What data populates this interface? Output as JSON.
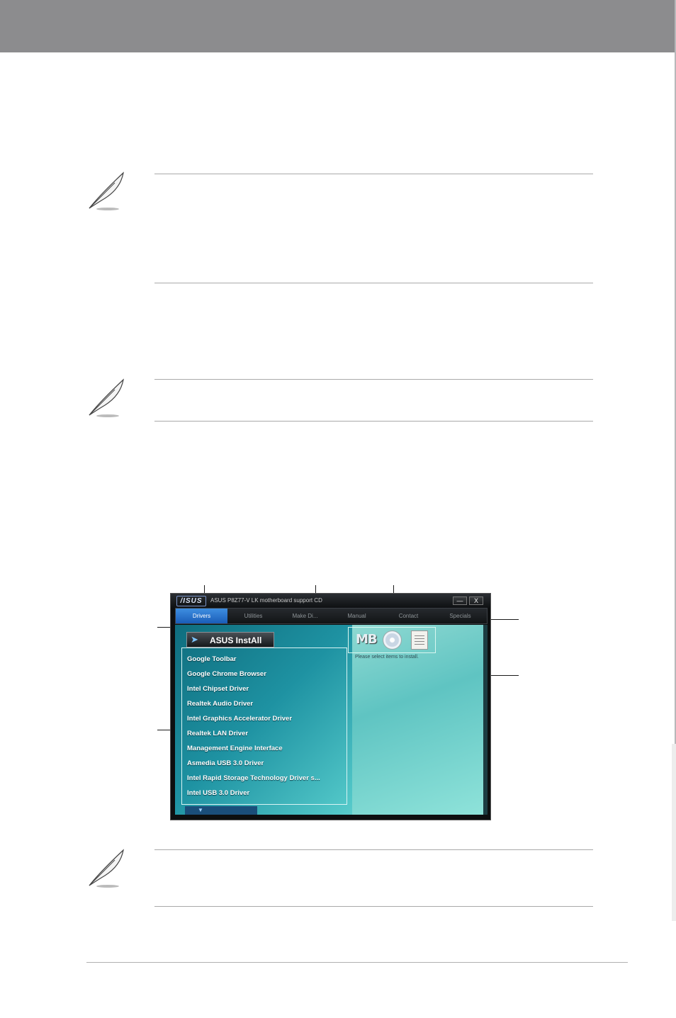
{
  "window": {
    "logo": "/ISUS",
    "title": "ASUS P8Z77-V LK motherboard support CD",
    "minimize_label": "—",
    "close_label": "X"
  },
  "tabs": [
    {
      "label": "Drivers",
      "active": true
    },
    {
      "label": "Utilities",
      "active": false
    },
    {
      "label": "Make Di...",
      "active": false
    },
    {
      "label": "Manual",
      "active": false
    },
    {
      "label": "Contact",
      "active": false
    },
    {
      "label": "Specials",
      "active": false
    }
  ],
  "install_all": {
    "label": "ASUS InstAll",
    "icon": "arrow-icon"
  },
  "drivers": [
    "Google Toolbar",
    "Google Chrome Browser",
    "Intel Chipset Driver",
    "Realtek Audio Driver",
    "Intel Graphics Accelerator Driver",
    "Realtek LAN Driver",
    "Management Engine Interface",
    "Asmedia USB 3.0 Driver",
    "Intel Rapid Storage Technology Driver s...",
    "Intel USB 3.0 Driver"
  ],
  "right_panel": {
    "mb_icon_label": "MB",
    "select_hint": "Please select items to install."
  },
  "colors": {
    "header_bar": "#8c8c8e",
    "active_tab": "#2a78d0",
    "content_teal": "#1e92a2"
  }
}
